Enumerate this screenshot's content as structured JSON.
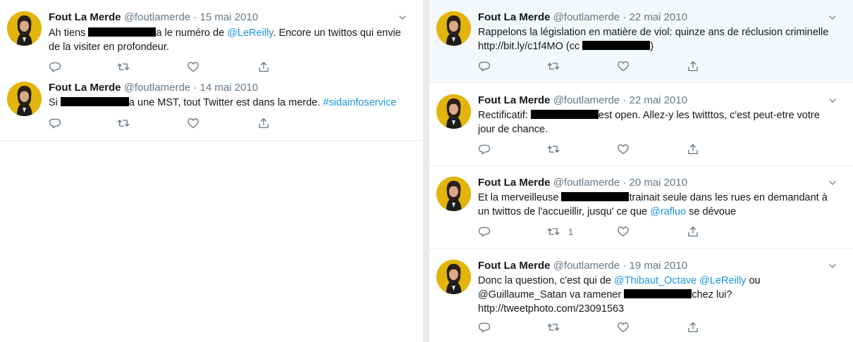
{
  "tweets_left": [
    {
      "name": "Fout La Merde",
      "handle": "@foutlamerde",
      "separator": "·",
      "date": "15 mai 2010",
      "line1_a": "Ah tiens ",
      "line1_b": "a le numéro de ",
      "line1_link": "@LeReilly",
      "line1_c": ". Encore un twittos qui envie",
      "line2": "de la visiter en profondeur."
    },
    {
      "name": "Fout La Merde",
      "handle": "@foutlamerde",
      "separator": "·",
      "date": "14 mai 2010",
      "line1_a": "Si ",
      "line1_b": "a une MST, tout Twitter est dans la merde. ",
      "line1_link": "#sidainfoservice"
    }
  ],
  "tweets_right": [
    {
      "name": "Fout La Merde",
      "handle": "@foutlamerde",
      "separator": "·",
      "date": "22 mai 2010",
      "line1": "Rappelons la législation en matière de viol: quinze ans de réclusion criminelle",
      "line2_a": "http://bit.ly/c1f4MO (cc ",
      "line2_b": ")"
    },
    {
      "name": "Fout La Merde",
      "handle": "@foutlamerde",
      "separator": "·",
      "date": "22 mai 2010",
      "line1_a": "Rectificatif: ",
      "line1_b": "est open. Allez-y les twitttos, c'est peut-etre votre",
      "line2": "jour de chance."
    },
    {
      "name": "Fout La Merde",
      "handle": "@foutlamerde",
      "separator": "·",
      "date": "20 mai 2010",
      "line1_a": "Et la merveilleuse ",
      "line1_b": "trainait seule dans les rues en demandant à",
      "line2_a": "un twittos de l'accueillir, jusqu' ce que ",
      "line2_link": "@rafluo",
      "line2_b": " se dévoue",
      "retweet_count": "1"
    },
    {
      "name": "Fout La Merde",
      "handle": "@foutlamerde",
      "separator": "·",
      "date": "19 mai 2010",
      "line1_a": "Donc la question, c'est qui de ",
      "line1_link1": "@Thibaut_Octave",
      "line1_space": " ",
      "line1_link2": "@LeReilly",
      "line1_b": " ou",
      "line2_a": "@Guillaume_Satan va ramener ",
      "line2_b": "chez lui?",
      "line3": "http://tweetphoto.com/23091563"
    }
  ],
  "icons": {
    "reply": "reply-icon",
    "retweet": "retweet-icon",
    "like": "heart-icon",
    "share": "share-icon",
    "menu": "chevron-down-icon"
  },
  "colors": {
    "link": "#1b95e0",
    "muted": "#657786",
    "avatar_bg": "#e6b800",
    "highlight_bg": "#f5f8fa"
  }
}
